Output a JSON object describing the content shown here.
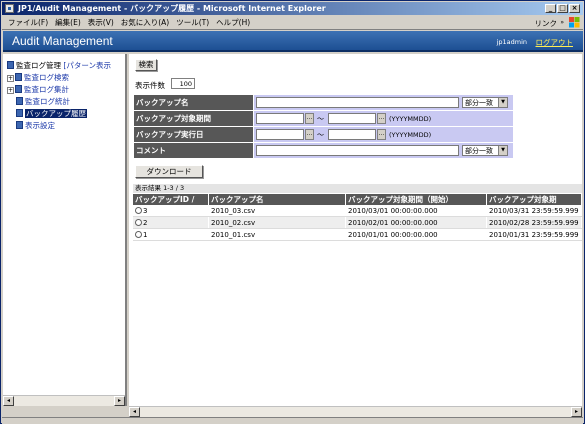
{
  "window": {
    "title": "JP1/Audit Management - バックアップ履歴 - Microsoft Internet Explorer",
    "minimize": "_",
    "maximize": "□",
    "close": "×"
  },
  "menu": {
    "items": [
      "ファイル(F)",
      "編集(E)",
      "表示(V)",
      "お気に入り(A)",
      "ツール(T)",
      "ヘルプ(H)"
    ],
    "links_label": "リンク",
    "links_arrow": "»"
  },
  "app": {
    "title": "Audit Management",
    "user": "jp1admin",
    "logout": "ログアウト"
  },
  "sidebar": {
    "root_label": "監査ログ管理",
    "root_link": "[パターン表示",
    "items": [
      {
        "label": "監査ログ検索",
        "expandable": true
      },
      {
        "label": "監査ログ集計",
        "expandable": true
      },
      {
        "label": "監査ログ統計",
        "expandable": false
      },
      {
        "label": "バックアップ履歴",
        "expandable": false
      },
      {
        "label": "表示設定",
        "expandable": false
      }
    ]
  },
  "search": {
    "button": "検索",
    "count_label": "表示件数",
    "count_value": "100"
  },
  "form": {
    "rows": [
      {
        "label": "バックアップ名"
      },
      {
        "label": "バックアップ対象期間"
      },
      {
        "label": "バックアップ実行日"
      },
      {
        "label": "コメント"
      }
    ],
    "match_mode": "部分一致",
    "tilde": "～",
    "date_format": "(YYYYMMDD)",
    "cal_button": "..."
  },
  "download_button": "ダウンロード",
  "results": {
    "summary": "表示結果 1-3 / 3",
    "headers": [
      "バックアップID /",
      "バックアップ名",
      "バックアップ対象期間（開始）",
      "バックアップ対象期"
    ],
    "rows": [
      {
        "id": "3",
        "name": "2010_03.csv",
        "start": "2010/03/01 00:00:00.000",
        "end": "2010/03/31 23:59:59.999"
      },
      {
        "id": "2",
        "name": "2010_02.csv",
        "start": "2010/02/01 00:00:00.000",
        "end": "2010/02/28 23:59:59.999"
      },
      {
        "id": "1",
        "name": "2010_01.csv",
        "start": "2010/01/01 00:00:00.000",
        "end": "2010/01/31 23:59:59.999"
      }
    ]
  },
  "scroll": {
    "left": "◂",
    "right": "▸"
  }
}
